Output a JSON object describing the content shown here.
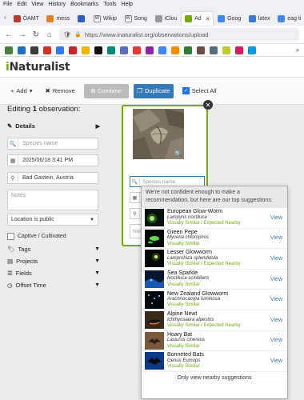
{
  "menu": [
    "File",
    "Edit",
    "View",
    "History",
    "Bookmarks",
    "Tools",
    "Help"
  ],
  "tabs": [
    {
      "label": "ÖAMT",
      "color": "#c0392b"
    },
    {
      "label": "mess",
      "color": "#e67e22"
    },
    {
      "label": "",
      "color": "#2d5fc8"
    },
    {
      "label": "Wikip",
      "color": "#555555"
    },
    {
      "label": "Song",
      "color": "#555555"
    },
    {
      "label": "iClou",
      "color": "#999999"
    },
    {
      "label": "Ad",
      "color": "#74ac00",
      "active": true
    },
    {
      "label": "Goog",
      "color": "#4285f4"
    },
    {
      "label": "latex",
      "color": "#3a7bd5"
    },
    {
      "label": "eag ti",
      "color": "#4285f4"
    }
  ],
  "url": "https://www.inaturalist.org/observations/upload",
  "bookmark_colors": [
    "#4a7c3a",
    "#1f6fbf",
    "#3b3b3b",
    "#d93025",
    "#2d7cf6",
    "#c62828",
    "#f4b400",
    "#111111",
    "#00897b",
    "#5c6bc0",
    "#e53935",
    "#8e24aa",
    "#4285f4",
    "#fb8c00",
    "#2e7d32",
    "#6d4c41",
    "#546e7a",
    "#c0ca33",
    "#d81b60",
    "#039be5"
  ],
  "header": {
    "logo_i": "i",
    "logo_rest": "Naturalist"
  },
  "toolbar": {
    "add": "Add",
    "remove": "Remove",
    "combine": "Combine",
    "duplicate": "Duplicate",
    "select_all": "Select All"
  },
  "editing": {
    "prefix": "Editing",
    "count": "1",
    "suffix": "observation:"
  },
  "details": {
    "section_label": "Details",
    "species_placeholder": "Species name",
    "datetime": "2025/06/18 3:41 PM",
    "location": "Bad Gastein, Austria",
    "notes_placeholder": "Notes",
    "geoprivacy": "Location is public",
    "captive_label": "Captive / Cultivated"
  },
  "sections": [
    "Tags",
    "Projects",
    "Fields",
    "Offset Time"
  ],
  "card": {
    "species_placeholder": "Species name",
    "notes_placeholder": "Note"
  },
  "suggestions": {
    "message": "We're not confident enough to make a recommendation, but here are our top suggestions:",
    "view_label": "View",
    "items": [
      {
        "common": "European Glow-Worm",
        "scientific": "Lampyris noctiluca",
        "tag": "Visually Similar / Expected Nearby"
      },
      {
        "common": "Green Pepe",
        "scientific": "Mycena chlorophos",
        "tag": "Visually Similar"
      },
      {
        "common": "Lesser Glowworm",
        "scientific": "Lamprohiza splendidula",
        "tag": "Visually Similar / Expected Nearby"
      },
      {
        "common": "Sea Sparkle",
        "scientific": "Noctiluca scintillans",
        "tag": "Visually Similar"
      },
      {
        "common": "New Zealand Glowworm",
        "scientific": "Arachnocampa luminosa",
        "tag": "Visually Similar"
      },
      {
        "common": "Alpine Newt",
        "scientific": "Ichthyosaura alpestris",
        "tag": "Visually Similar / Expected Nearby"
      },
      {
        "common": "Hoary Bat",
        "scientific": "Lasiurus cinereus",
        "tag": "Visually Similar"
      },
      {
        "common": "Bonneted Bats",
        "scientific": "Genus Eumops",
        "tag": "Visually Similar"
      }
    ],
    "footer": "Only view nearby suggestions"
  }
}
